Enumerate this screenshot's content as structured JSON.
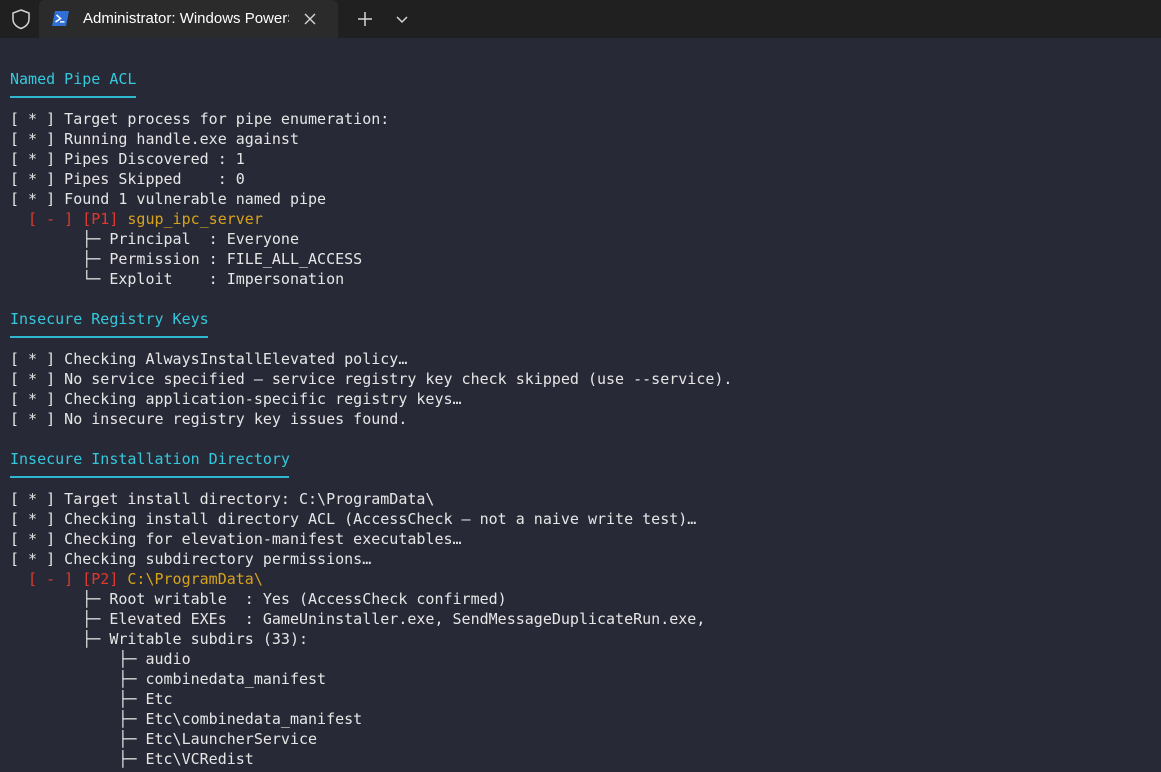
{
  "titlebar": {
    "tab_title": "Administrator: Windows PowerShell"
  },
  "icons": {
    "shield": "shield-icon",
    "powershell": "powershell-icon",
    "close": "close-icon",
    "new_tab": "plus-icon",
    "dropdown": "chevron-down-icon"
  },
  "colors": {
    "background": "#272a36",
    "heading": "#35c8dc",
    "finding_marker": "#e03a2e",
    "finding_name": "#d9a21b",
    "text": "#e6e6e6"
  },
  "sections": {
    "pipe": {
      "heading": "Named Pipe ACL",
      "lines": [
        "[ * ] Target process for pipe enumeration:",
        "[ * ] Running handle.exe against",
        "[ * ] Pipes Discovered : 1",
        "[ * ] Pipes Skipped    : 0",
        "[ * ] Found 1 vulnerable named pipe"
      ],
      "finding": {
        "marker": "  [ - ] [P1] ",
        "name": "sgup_ipc_server"
      },
      "details": [
        "        ├─ Principal  : Everyone",
        "        ├─ Permission : FILE_ALL_ACCESS",
        "        └─ Exploit    : Impersonation"
      ]
    },
    "registry": {
      "heading": "Insecure Registry Keys",
      "lines": [
        "[ * ] Checking AlwaysInstallElevated policy…",
        "[ * ] No service specified — service registry key check skipped (use --service).",
        "[ * ] Checking application-specific registry keys…",
        "[ * ] No insecure registry key issues found."
      ]
    },
    "install": {
      "heading": "Insecure Installation Directory",
      "lines": [
        "[ * ] Target install directory: C:\\ProgramData\\",
        "[ * ] Checking install directory ACL (AccessCheck — not a naive write test)…",
        "[ * ] Checking for elevation-manifest executables…",
        "[ * ] Checking subdirectory permissions…"
      ],
      "finding": {
        "marker": "  [ - ] [P2] ",
        "name": "C:\\ProgramData\\"
      },
      "details": [
        "        ├─ Root writable  : Yes (AccessCheck confirmed)",
        "        ├─ Elevated EXEs  : GameUninstaller.exe, SendMessageDuplicateRun.exe,",
        "        ├─ Writable subdirs (33):"
      ],
      "subdirs": [
        "            ├─ audio",
        "            ├─ combinedata_manifest",
        "            ├─ Etc",
        "            ├─ Etc\\combinedata_manifest",
        "            ├─ Etc\\LauncherService",
        "            ├─ Etc\\VCRedist"
      ]
    }
  }
}
